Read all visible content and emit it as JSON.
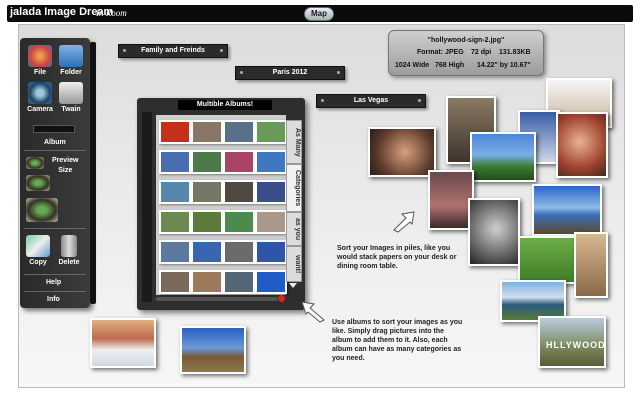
{
  "app": {
    "title": "jalada Image Dream",
    "subtitle": "In Room",
    "map_button": "Map"
  },
  "toolbar": {
    "file": "File",
    "folder": "Folder",
    "camera": "Camera",
    "twain": "Twain",
    "album": "Album",
    "preview_size": "Preview\nSize",
    "copy": "Copy",
    "delete": "Delete",
    "help": "Help",
    "info": "Info"
  },
  "piles": {
    "family": "Family and Freinds",
    "paris": "Paris 2012",
    "vegas": "Las Vegas"
  },
  "album": {
    "title": "Multible Albums!",
    "tabs": [
      "As Many",
      "Categories",
      "as you",
      "want!"
    ]
  },
  "image_info": {
    "filename": "\"hollywood-sign-2.jpg\"",
    "format": "Format: JPEG",
    "dpi": "72 dpi",
    "size": "131.83KB",
    "wide": "1024 Wide",
    "high": "768 High",
    "dims": "14.22\" by 10.67\""
  },
  "notes": {
    "stack": "Sort your Images in piles, like you would stack papers on your desk or dining room table.",
    "albums": "Use albums to sort your images as you like. Simply drag pictures into the album to add them to it. Also, each album can have as many categories as you need."
  },
  "colors": {
    "topbar": "#0b0b0b",
    "panel": "#2e2e2e",
    "stage": "#e6e6e6"
  }
}
